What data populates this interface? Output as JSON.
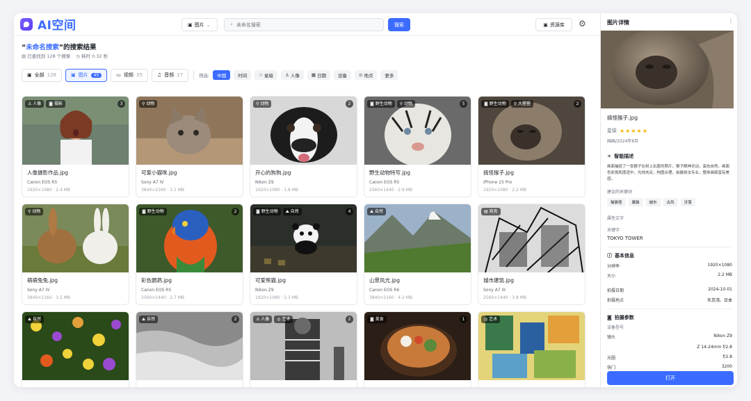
{
  "app": {
    "title": "AI空间"
  },
  "header": {
    "type_select": "图片",
    "search_placeholder": "未命名搜索",
    "search_button": "搜索",
    "library_button": "资源库"
  },
  "results": {
    "title_open": "“",
    "query": "未命名搜索",
    "title_suffix": "”的搜索结果",
    "found": "已查找到 128 个搜索",
    "time": "耗时 0.32 秒"
  },
  "tabs": [
    {
      "label": "全部",
      "count": "128"
    },
    {
      "label": "图片",
      "count": "45"
    },
    {
      "label": "视频",
      "count": "35"
    },
    {
      "label": "音频",
      "count": "17"
    }
  ],
  "filters": {
    "label": "筛选:",
    "chips": [
      "中国",
      "时间",
      "星级",
      "人像",
      "日期",
      "设备",
      "地点",
      "更多"
    ]
  },
  "cards": [
    {
      "tags": [
        "人像",
        "摄影"
      ],
      "count": "3",
      "name": "人像摄影作品.jpg",
      "device": "Canon EOS R5",
      "specs": "1920×1080 · 2.4 MB"
    },
    {
      "tags": [
        "动物"
      ],
      "count": "",
      "name": "可爱小猫咪.jpg",
      "device": "Sony A7 IV",
      "specs": "3840×2160 · 3.1 MB"
    },
    {
      "tags": [
        "动物"
      ],
      "count": "2",
      "name": "开心的狗狗.jpg",
      "device": "Nikon Z9",
      "specs": "1920×1080 · 1.8 MB"
    },
    {
      "tags": [
        "野生动物",
        "动物"
      ],
      "count": "5",
      "name": "野生动物特写.jpg",
      "device": "Canon EOS R5",
      "specs": "2560×1440 · 2.9 MB"
    },
    {
      "tags": [
        "野生动物",
        "大猩猩"
      ],
      "count": "2",
      "name": "搞怪猴子.jpg",
      "device": "iPhone 15 Pro",
      "specs": "1920×1080 · 2.2 MB"
    },
    {
      "tags": [
        "动物"
      ],
      "count": "",
      "name": "萌萌兔兔.jpg",
      "device": "Sony A7 IV",
      "specs": "3840×2160 · 3.5 MB"
    },
    {
      "tags": [
        "野生动物"
      ],
      "count": "2",
      "name": "彩色鹦鹉.jpg",
      "device": "Canon EOS R5",
      "specs": "2560×1440 · 2.7 MB"
    },
    {
      "tags": [
        "野生动物",
        "自然"
      ],
      "count": "4",
      "name": "可爱熊猫.jpg",
      "device": "Nikon Z9",
      "specs": "1920×1080 · 2.3 MB"
    },
    {
      "tags": [
        "自然"
      ],
      "count": "",
      "name": "山景风光.jpg",
      "device": "Canon EOS R6",
      "specs": "3840×2160 · 4.2 MB"
    },
    {
      "tags": [
        "商务"
      ],
      "count": "",
      "name": "城市建筑.jpg",
      "device": "Sony A7 III",
      "specs": "2560×1440 · 3.8 MB"
    },
    {
      "tags": [
        "自然"
      ],
      "count": "",
      "name": "",
      "device": "",
      "specs": ""
    },
    {
      "tags": [
        "自然"
      ],
      "count": "2",
      "name": "",
      "device": "",
      "specs": ""
    },
    {
      "tags": [
        "人像",
        "艺术"
      ],
      "count": "2",
      "name": "",
      "device": "",
      "specs": ""
    },
    {
      "tags": [
        "美食"
      ],
      "count": "1",
      "name": "",
      "device": "",
      "specs": ""
    },
    {
      "tags": [
        "艺术"
      ],
      "count": "",
      "name": "",
      "device": "",
      "specs": ""
    }
  ],
  "detail": {
    "title": "图片详情",
    "file_name": "搞怪猴子.jpg",
    "rating_label": "星级",
    "stars": "★★★★★",
    "sub": "国画/2024年8月",
    "ai_heading": "智能描述",
    "ai_desc": "画面捕捉了一张猴子在树上玩耍的照片，猴子眼神灵动，姿态自然。画面色彩饱和度适中，光线充足，构图合理，拍摄技法专业，整体画面富有美感。",
    "keywords_label": "建议的关键词",
    "keywords": [
      "猫猫怪",
      "暴躁",
      "城市",
      "古风",
      "牙落"
    ],
    "attr_label": "属性文字",
    "keyword_label": "关键字",
    "keyword_value": "TOKYO TOWER",
    "basic_heading": "基本信息",
    "basic": [
      {
        "k": "分辨率",
        "v": "1920×1080"
      },
      {
        "k": "大小",
        "v": "2.2 MB"
      },
      {
        "k": "拍摄日期",
        "v": "2024-10-01"
      },
      {
        "k": "拍摄地点",
        "v": "东京湾、日本"
      }
    ],
    "shoot_heading": "拍摄参数",
    "device_label": "设备型号",
    "shoot": [
      {
        "k": "镜头",
        "v": "Nikon Z9"
      },
      {
        "k": "",
        "v": "Z 14-24mm f/2.8"
      },
      {
        "k": "光圈",
        "v": "f/2.8"
      },
      {
        "k": "快门",
        "v": "3200"
      }
    ],
    "open_button": "打开"
  }
}
